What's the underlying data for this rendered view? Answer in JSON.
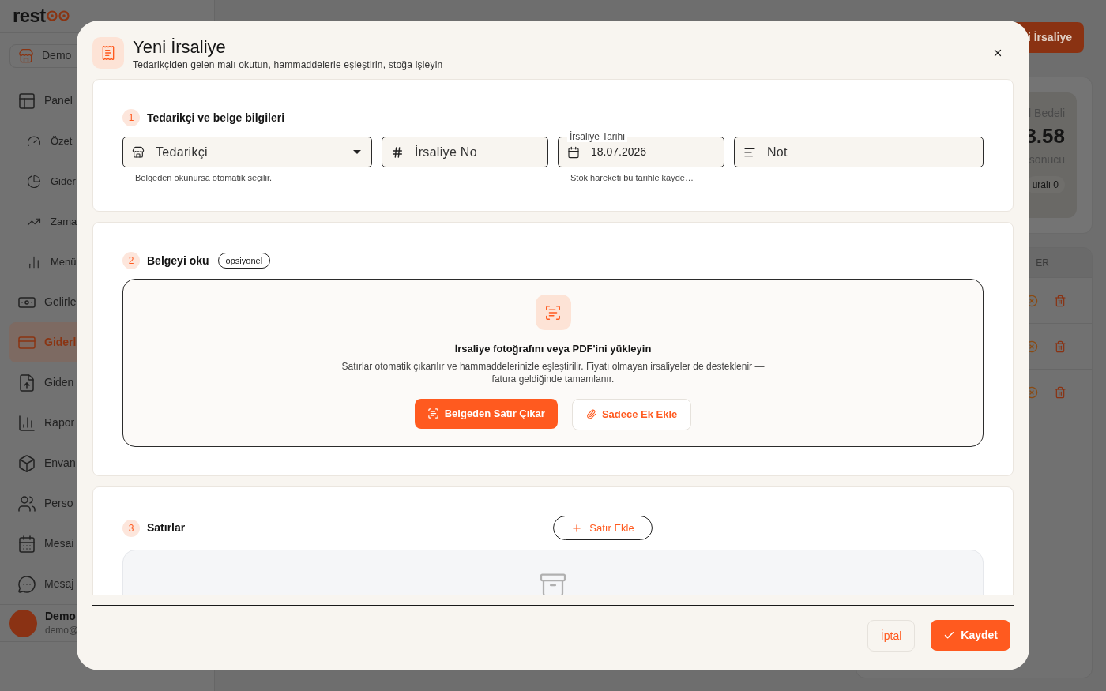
{
  "background": {
    "logo": "rest",
    "store": "Demo",
    "nav": [
      {
        "label": "Panel",
        "selected": false,
        "children": [
          {
            "label": "Özet",
            "selected": false
          },
          {
            "label": "Gider",
            "selected": false
          },
          {
            "label": "Zama",
            "selected": false
          },
          {
            "label": "Menü",
            "selected": false
          }
        ]
      },
      {
        "label": "Gelirle",
        "selected": false
      },
      {
        "label": "Giderl",
        "selected": true
      },
      {
        "label": "Giden",
        "selected": false
      },
      {
        "label": "Rapor",
        "selected": false
      },
      {
        "label": "Envan",
        "selected": false
      },
      {
        "label": "Perso",
        "selected": false
      },
      {
        "label": "Mesai",
        "selected": false
      },
      {
        "label": "Mesaj",
        "selected": false
      }
    ],
    "user": {
      "name": "Demo",
      "email": "demo@"
    },
    "header_button": "i İrsaliye",
    "stat": {
      "label": "l Bedeli",
      "value": "3.58",
      "caption": "sonucu",
      "pill": "uralı 0"
    },
    "table": {
      "column": "ER",
      "rows": [
        {
          "kind": "actions"
        },
        {
          "kind": "actions"
        },
        {
          "kind": "actions"
        }
      ]
    }
  },
  "dialog": {
    "title": "Yeni İrsaliye",
    "subtitle": "Tedarikçiden gelen malı okutun, hammaddelerle eşleştirin, stoğa işleyin",
    "sections": [
      {
        "number": "1",
        "title": "Tedarikçi ve belge bilgileri",
        "fields": [
          {
            "kind": "select",
            "placeholder": "Tedarikçi",
            "helper": "Belgeden okunursa otomatik seçilir."
          },
          {
            "kind": "number",
            "placeholder": "İrsaliye No"
          },
          {
            "kind": "date",
            "label": "İrsaliye Tarihi",
            "value": "18.07.2026",
            "helper": "Stok hareketi bu tarihle kayde…"
          },
          {
            "kind": "note",
            "placeholder": "Not"
          }
        ]
      },
      {
        "number": "2",
        "title": "Belgeyi oku",
        "badge": "opsiyonel",
        "upload": {
          "title": "İrsaliye fotoğrafını veya PDF'ini yükleyin",
          "text": "Satırlar otomatik çıkarılır ve hammaddelerinizle eşleştirilir. Fiyatı olmayan irsaliyeler de desteklenir — fatura geldiğinde tamamlanır.",
          "primary": "Belgeden Satır Çıkar",
          "secondary": "Sadece Ek Ekle"
        }
      },
      {
        "number": "3",
        "title": "Satırlar",
        "action": "Satır Ekle"
      }
    ],
    "cancel": "İptal",
    "save": "Kaydet"
  }
}
